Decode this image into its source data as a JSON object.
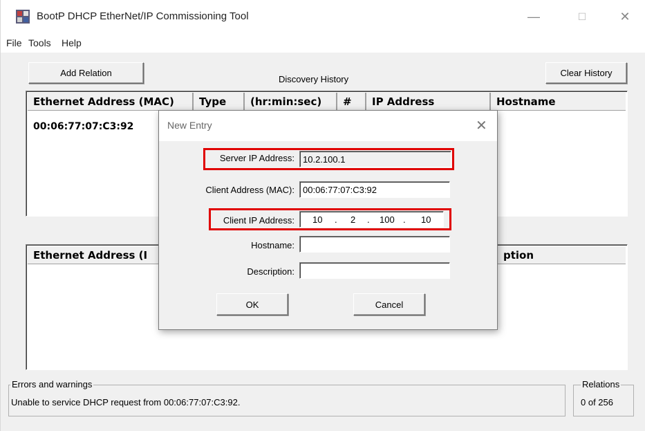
{
  "window": {
    "title": "BootP DHCP EtherNet/IP Commissioning Tool",
    "controls": {
      "minimize": "—",
      "maximize": "☐",
      "close": "✕"
    }
  },
  "menu": [
    "File",
    "Tools",
    "Help"
  ],
  "toolbar": {
    "add_relation": "Add Relation",
    "discovery_history": "Discovery History",
    "clear_history": "Clear History"
  },
  "discovery_table": {
    "columns": [
      "Ethernet Address (MAC)",
      "Type",
      "(hr:min:sec)",
      "#",
      "IP Address",
      "Hostname"
    ],
    "rows": [
      {
        "mac": "00:06:77:07:C3:92"
      }
    ]
  },
  "relation_table": {
    "columns": [
      "Ethernet Address (I",
      "ption"
    ]
  },
  "status": {
    "errors_title": "Errors and warnings",
    "errors_message": "Unable to service DHCP request from 00:06:77:07:C3:92.",
    "relations_title": "Relations",
    "relations_count": "0 of 256"
  },
  "dialog": {
    "title": "New Entry",
    "close": "✕",
    "server_ip_label": "Server IP Address:",
    "server_ip_value": "10.2.100.1",
    "client_mac_label": "Client Address (MAC):",
    "client_mac_value": "00:06:77:07:C3:92",
    "client_ip_label": "Client IP Address:",
    "client_ip_parts": [
      "10",
      "2",
      "100",
      "10"
    ],
    "client_ip_sep": ".",
    "hostname_label": "Hostname:",
    "hostname_value": "",
    "description_label": "Description:",
    "description_value": "",
    "ok": "OK",
    "cancel": "Cancel"
  },
  "colors": {
    "highlight": "#e00000",
    "window_bg": "#f0f0f0"
  }
}
